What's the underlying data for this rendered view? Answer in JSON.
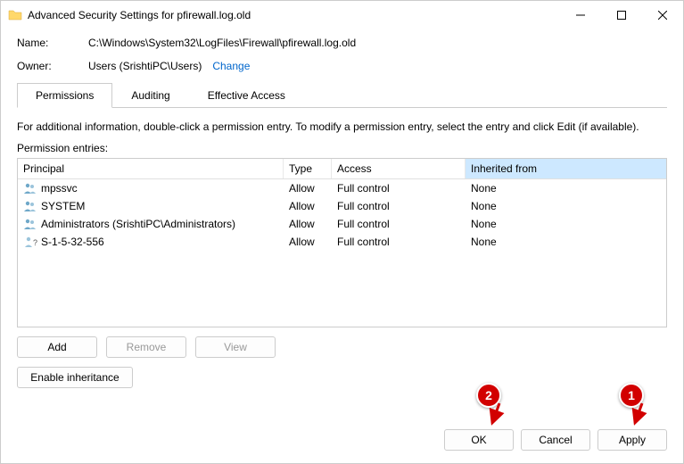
{
  "titlebar": {
    "title": "Advanced Security Settings for pfirewall.log.old"
  },
  "info": {
    "name_label": "Name:",
    "name_value": "C:\\Windows\\System32\\LogFiles\\Firewall\\pfirewall.log.old",
    "owner_label": "Owner:",
    "owner_value": "Users (SrishtiPC\\Users)",
    "change_label": "Change"
  },
  "tabs": {
    "permissions": "Permissions",
    "auditing": "Auditing",
    "effective": "Effective Access"
  },
  "helper_text": "For additional information, double-click a permission entry. To modify a permission entry, select the entry and click Edit (if available).",
  "entries_label": "Permission entries:",
  "table": {
    "headers": {
      "principal": "Principal",
      "type": "Type",
      "access": "Access",
      "inherited": "Inherited from"
    },
    "rows": [
      {
        "principal": "mpssvc",
        "type": "Allow",
        "access": "Full control",
        "inherited": "None",
        "icon": "group"
      },
      {
        "principal": "SYSTEM",
        "type": "Allow",
        "access": "Full control",
        "inherited": "None",
        "icon": "group"
      },
      {
        "principal": "Administrators (SrishtiPC\\Administrators)",
        "type": "Allow",
        "access": "Full control",
        "inherited": "None",
        "icon": "group"
      },
      {
        "principal": "S-1-5-32-556",
        "type": "Allow",
        "access": "Full control",
        "inherited": "None",
        "icon": "unknown"
      }
    ]
  },
  "buttons": {
    "add": "Add",
    "remove": "Remove",
    "view": "View",
    "enable_inheritance": "Enable inheritance",
    "ok": "OK",
    "cancel": "Cancel",
    "apply": "Apply"
  },
  "callouts": {
    "c1": "1",
    "c2": "2"
  }
}
